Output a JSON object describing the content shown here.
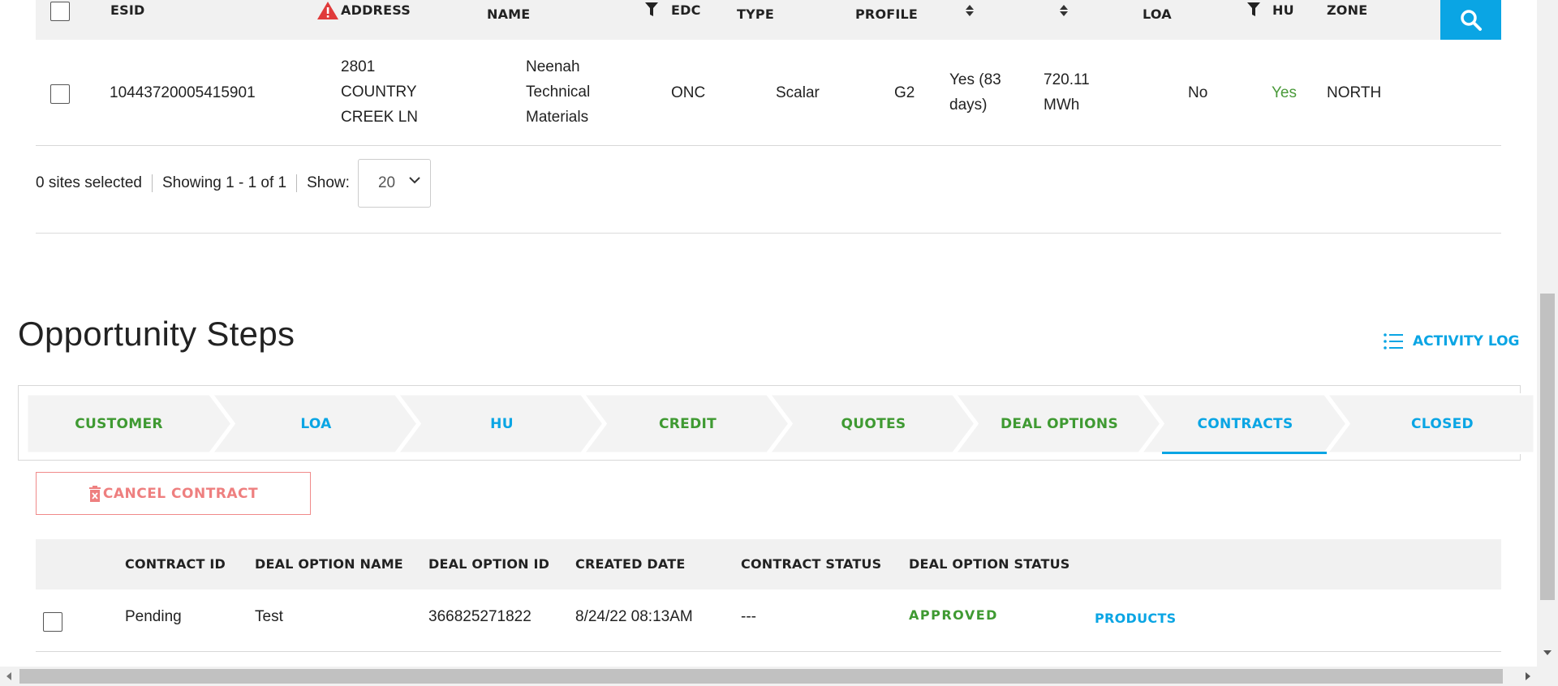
{
  "sites_table": {
    "headers": {
      "esid": "ESID",
      "address": "ADDRESS",
      "name": "NAME",
      "edc": "EDC",
      "type": "TYPE",
      "profile": "PROFILE",
      "loa": "LOA",
      "hu": "HU",
      "zone": "ZONE"
    },
    "row": {
      "esid": "10443720005415901",
      "address_lines": [
        "2801",
        "COUNTRY",
        "CREEK LN"
      ],
      "name_lines": [
        "Neenah",
        "Technical",
        "Materials"
      ],
      "edc": "ONC",
      "type": "Scalar",
      "profile": "G2",
      "col_a_lines": [
        "Yes (83",
        "days)"
      ],
      "col_b_lines": [
        "720.11",
        "MWh"
      ],
      "loa": "No",
      "hu": "Yes",
      "zone": "NORTH"
    },
    "pager": {
      "selected": "0 sites selected",
      "showing": "Showing 1 - 1 of 1",
      "show_label": "Show:",
      "show_value": "20"
    }
  },
  "opportunity": {
    "title": "Opportunity Steps",
    "activity_log": "ACTIVITY LOG",
    "steps": [
      {
        "label": "CUSTOMER",
        "color": "#3f9a32"
      },
      {
        "label": "LOA",
        "color": "#0aa5e4"
      },
      {
        "label": "HU",
        "color": "#0aa5e4"
      },
      {
        "label": "CREDIT",
        "color": "#3f9a32"
      },
      {
        "label": "QUOTES",
        "color": "#3f9a32"
      },
      {
        "label": "DEAL OPTIONS",
        "color": "#3f9a32"
      },
      {
        "label": "CONTRACTS",
        "color": "#0aa5e4",
        "active": true
      },
      {
        "label": "CLOSED",
        "color": "#0aa5e4"
      }
    ]
  },
  "contracts": {
    "cancel_button": "CANCEL CONTRACT",
    "headers": {
      "contract_id": "CONTRACT ID",
      "deal_option_name": "DEAL OPTION NAME",
      "deal_option_id": "DEAL OPTION ID",
      "created_date": "CREATED DATE",
      "contract_status": "CONTRACT STATUS",
      "deal_option_status": "DEAL OPTION STATUS"
    },
    "row": {
      "contract_id": "Pending",
      "deal_option_name": "Test",
      "deal_option_id": "366825271822",
      "created_date": "8/24/22 08:13AM",
      "contract_status": "---",
      "deal_option_status": "APPROVED",
      "products_link": "PRODUCTS"
    }
  },
  "colors": {
    "accent_blue": "#0aa5e4",
    "status_green": "#3f9a32",
    "danger_red": "#ee7f7f",
    "header_bg": "#f1f1f1"
  },
  "icons": {
    "search": "search-icon",
    "warning": "warning-icon",
    "filter": "filter-icon",
    "sort": "sort-icon",
    "list": "list-icon",
    "trash": "trash-icon"
  }
}
